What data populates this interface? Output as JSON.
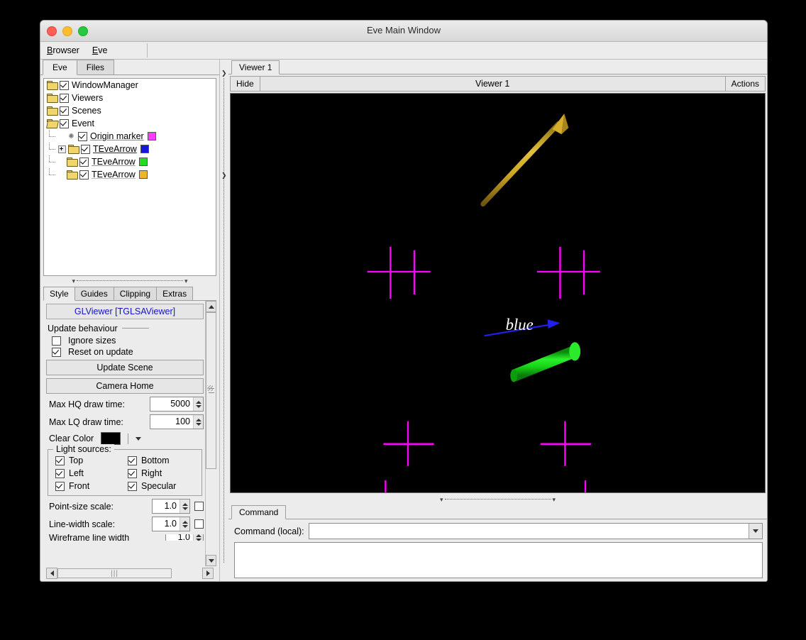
{
  "window": {
    "title": "Eve Main Window"
  },
  "menubar": {
    "items": [
      {
        "label": "Browser",
        "mnemonic": "B"
      },
      {
        "label": "Eve",
        "mnemonic": "E"
      }
    ]
  },
  "left": {
    "tabs": [
      {
        "label": "Eve",
        "active": true
      },
      {
        "label": "Files",
        "active": false
      }
    ],
    "tree": [
      {
        "label": "WindowManager",
        "checked": true,
        "level": 0,
        "type": "folder",
        "swatch": null,
        "expander": null,
        "underline": null
      },
      {
        "label": "Viewers",
        "checked": true,
        "level": 0,
        "type": "folder",
        "swatch": null,
        "expander": null,
        "underline": null
      },
      {
        "label": "Scenes",
        "checked": true,
        "level": 0,
        "type": "folder",
        "swatch": null,
        "expander": null,
        "underline": null
      },
      {
        "label": "Event",
        "checked": true,
        "level": 0,
        "type": "folder-open",
        "swatch": null,
        "expander": null,
        "underline": null
      },
      {
        "label": "Origin marker",
        "checked": true,
        "level": 1,
        "type": "marker",
        "swatch": "#ff3cff",
        "expander": null,
        "underline": "#ff3cff"
      },
      {
        "label": "TEveArrow",
        "checked": true,
        "level": 1,
        "type": "folder",
        "swatch": "#1717d8",
        "expander": "plus",
        "underline": "#1717d8"
      },
      {
        "label": "TEveArrow",
        "checked": true,
        "level": 1,
        "type": "folder",
        "swatch": "#22dd22",
        "expander": null,
        "underline": "#22dd22"
      },
      {
        "label": "TEveArrow",
        "checked": true,
        "level": 1,
        "type": "folder",
        "swatch": "#f0b428",
        "expander": null,
        "underline": "#f0b428"
      }
    ],
    "style": {
      "tabs": [
        {
          "label": "Style",
          "active": true
        },
        {
          "label": "Guides",
          "active": false
        },
        {
          "label": "Clipping",
          "active": false
        },
        {
          "label": "Extras",
          "active": false
        }
      ],
      "viewer_title": "GLViewer [TGLSAViewer]",
      "update_group_label": "Update behaviour",
      "ignore_sizes": {
        "label": "Ignore sizes",
        "checked": false
      },
      "reset_on_update": {
        "label": "Reset on update",
        "checked": true
      },
      "update_scene_label": "Update Scene",
      "camera_home_label": "Camera Home",
      "max_hq": {
        "label": "Max HQ draw time:",
        "value": "5000"
      },
      "max_lq": {
        "label": "Max LQ draw time:",
        "value": "100"
      },
      "clear_color": {
        "label": "Clear Color",
        "value": "#000000"
      },
      "lights": {
        "legend": "Light sources:",
        "items": [
          {
            "label": "Top",
            "checked": true
          },
          {
            "label": "Bottom",
            "checked": true
          },
          {
            "label": "Left",
            "checked": true
          },
          {
            "label": "Right",
            "checked": true
          },
          {
            "label": "Front",
            "checked": true
          },
          {
            "label": "Specular",
            "checked": true
          }
        ]
      },
      "point_size": {
        "label": "Point-size scale:",
        "value": "1.0",
        "checked": false
      },
      "line_width": {
        "label": "Line-width scale:",
        "value": "1.0",
        "checked": false
      },
      "wireframe": {
        "label": "Wireframe line width",
        "value": "1.0"
      }
    }
  },
  "viewer": {
    "tabs": [
      {
        "label": "Viewer 1",
        "active": true
      }
    ],
    "toolbar": {
      "hide_label": "Hide",
      "title": "Viewer 1",
      "actions_label": "Actions"
    },
    "scene": {
      "background": "#000000",
      "objects": [
        {
          "name": "gold-arrow",
          "color": "#c9a227",
          "label": null
        },
        {
          "name": "blue-arrow",
          "color": "#2020ee",
          "label": "blue"
        },
        {
          "name": "green-cylinder",
          "color": "#16d316",
          "label": null
        },
        {
          "name": "origin-markers",
          "color": "#ff00ff",
          "label": null
        }
      ]
    }
  },
  "command": {
    "tabs": [
      {
        "label": "Command",
        "active": true
      }
    ],
    "label": "Command (local):",
    "value": "",
    "placeholder": ""
  }
}
